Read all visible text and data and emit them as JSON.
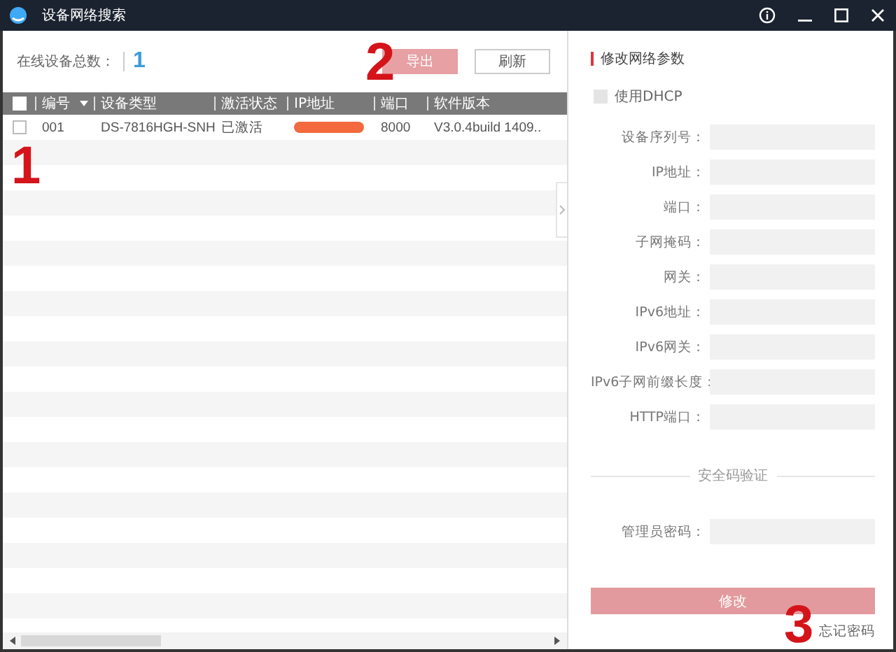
{
  "window": {
    "title": "设备网络搜索"
  },
  "toolbar": {
    "count_label": "在线设备总数：",
    "count": "1",
    "buttons": [
      {
        "label": "导出",
        "disabled": true
      },
      {
        "label": "刷新",
        "disabled": false
      }
    ]
  },
  "table": {
    "header_checked": false,
    "columns": [
      {
        "label": "编号",
        "sorted": true
      },
      {
        "label": "设备类型",
        "sorted": false
      },
      {
        "label": "激活状态",
        "sorted": false
      },
      {
        "label": "IP地址",
        "sorted": false
      },
      {
        "label": "端口",
        "sorted": false
      },
      {
        "label": "软件版本",
        "sorted": false
      }
    ],
    "rows": [
      {
        "checked": false,
        "number": "001",
        "type": "DS-7816HGH-SNH",
        "status": "已激活",
        "ip_redacted": true,
        "port": "8000",
        "version": "V3.0.4build 1409.."
      }
    ]
  },
  "panel": {
    "title": "修改网络参数",
    "dhcp": {
      "label": "使用DHCP",
      "checked": false
    },
    "fields": [
      {
        "label": "设备序列号："
      },
      {
        "label": "IP地址："
      },
      {
        "label": "端口："
      },
      {
        "label": "子网掩码："
      },
      {
        "label": "网关："
      },
      {
        "label": "IPv6地址："
      },
      {
        "label": "IPv6网关："
      },
      {
        "label": "IPv6子网前缀长度："
      },
      {
        "label": "HTTP端口："
      }
    ],
    "section": "安全码验证",
    "password": {
      "label": "管理员密码："
    },
    "submit": {
      "label": "修改",
      "disabled": true
    },
    "forgot": "忘记密码"
  },
  "annotations": [
    {
      "label": "1"
    },
    {
      "label": "2"
    },
    {
      "label": "3"
    }
  ]
}
